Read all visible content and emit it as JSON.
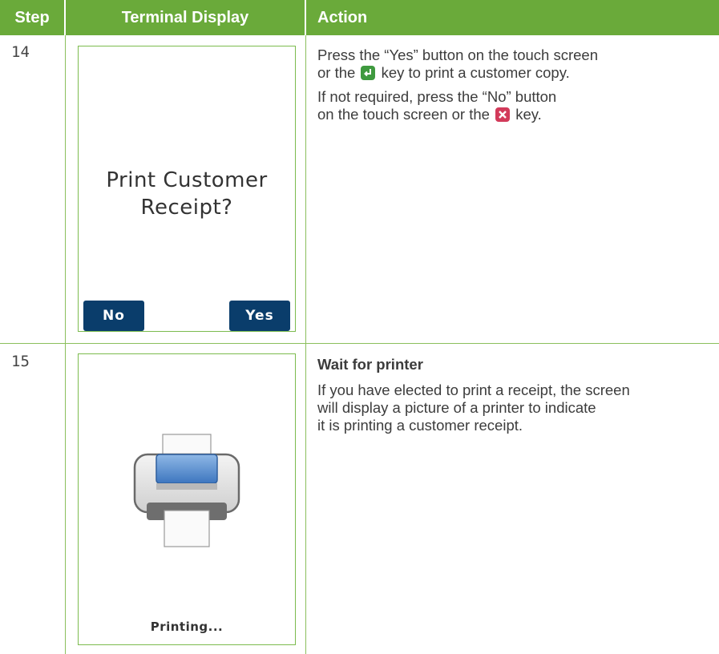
{
  "header": {
    "step": "Step",
    "display": "Terminal Display",
    "action": "Action"
  },
  "rows": [
    {
      "step": "14",
      "screen": {
        "prompt_line1": "Print Customer",
        "prompt_line2": "Receipt?",
        "no_label": "No",
        "yes_label": "Yes"
      },
      "action": {
        "p1_a": "Press the “Yes” button on the touch screen",
        "p1_b": "or the",
        "p1_c": "key to print a customer copy.",
        "p2_a": "If not required, press the “No” button",
        "p2_b": "on the touch screen or the",
        "p2_c": "key."
      }
    },
    {
      "step": "15",
      "screen": {
        "status": "Printing..."
      },
      "action": {
        "title": "Wait for printer",
        "p1_a": "If you have elected to print a receipt, the screen",
        "p1_b": "will display a picture of a printer to indicate",
        "p1_c": "it is printing a customer receipt."
      }
    }
  ],
  "icons": {
    "enter_key": "enter-key-icon",
    "cancel_key": "cancel-key-icon",
    "printer": "printer-icon"
  },
  "colors": {
    "header_bg": "#6aaa3a",
    "rule": "#8bbf5c",
    "button_bg": "#0a3d6b",
    "enter_key": "#3f9a3f",
    "cancel_key": "#d23a5a"
  }
}
